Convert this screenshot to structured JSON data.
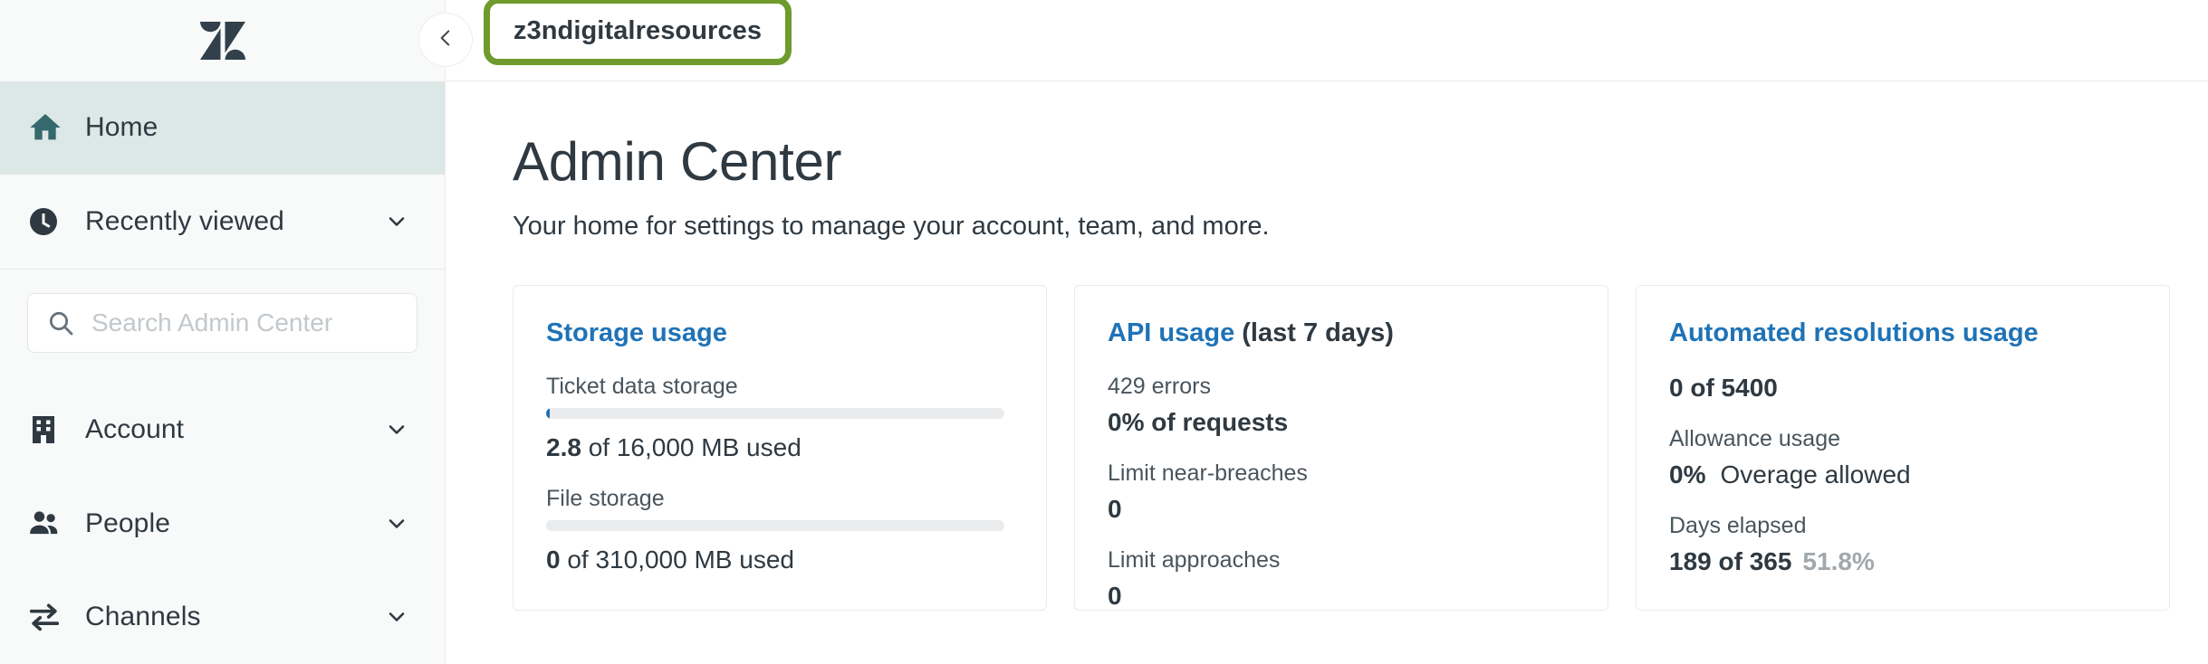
{
  "brand": {
    "logo_name": "zendesk-logo"
  },
  "sidebar": {
    "search": {
      "placeholder": "Search Admin Center",
      "value": ""
    },
    "items": [
      {
        "label": "Home",
        "icon": "home-icon",
        "active": true,
        "chevron": false
      },
      {
        "label": "Recently viewed",
        "icon": "clock-icon",
        "active": false,
        "chevron": true
      },
      {
        "label": "Account",
        "icon": "building-icon",
        "active": false,
        "chevron": true
      },
      {
        "label": "People",
        "icon": "people-icon",
        "active": false,
        "chevron": true
      },
      {
        "label": "Channels",
        "icon": "channels-arrows-icon",
        "active": false,
        "chevron": true
      }
    ]
  },
  "topbar": {
    "collapse_icon": "chevron-left-icon",
    "active_tab": "z3ndigitalresources",
    "highlight_color": "#6e9b2b"
  },
  "main": {
    "title": "Admin Center",
    "subtitle": "Your home for settings to manage your account, team, and more.",
    "cards": [
      {
        "title": "Storage usage",
        "title_suffix": "",
        "metrics": [
          {
            "label": "Ticket data storage",
            "bar": true,
            "bar_pct": 0.4,
            "value_strong": "2.8",
            "value_rest": " of 16,000 MB used"
          },
          {
            "label": "File storage",
            "bar": true,
            "bar_pct": 0,
            "value_strong": "0",
            "value_rest": " of 310,000 MB used"
          }
        ]
      },
      {
        "title": "API usage",
        "title_suffix": " (last 7 days)",
        "metrics": [
          {
            "label": "429 errors",
            "bar": false,
            "value_strong": "0% of requests",
            "value_rest": ""
          },
          {
            "label": "Limit near-breaches",
            "bar": false,
            "value_strong": "0",
            "value_rest": ""
          },
          {
            "label": "Limit approaches",
            "bar": false,
            "value_strong": "0",
            "value_rest": ""
          }
        ]
      },
      {
        "title": "Automated resolutions usage",
        "title_suffix": "",
        "metrics": [
          {
            "label": "",
            "bar": false,
            "value_strong": "0 of 5400",
            "value_rest": ""
          },
          {
            "label": "Allowance usage",
            "bar": false,
            "value_strong": "0%",
            "value_rest": "Overage allowed"
          },
          {
            "label": "Days elapsed",
            "bar": false,
            "value_strong": "189 of 365",
            "value_rest": "",
            "value_muted": "51.8%"
          }
        ]
      }
    ]
  },
  "colors": {
    "accent_link": "#1f73b7",
    "active_nav_bg": "#dce8e6",
    "highlight_green": "#6e9b2b",
    "text": "#2f3941"
  }
}
